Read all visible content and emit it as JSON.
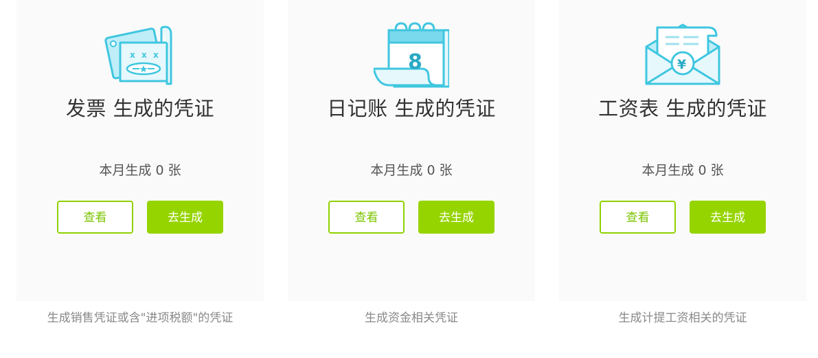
{
  "colors": {
    "accent_green": "#96d400",
    "icon_cyan": "#3fc6e0",
    "icon_fill": "#e6f8fc",
    "card_bg": "#fafafa"
  },
  "cards": [
    {
      "icon": "invoice-icon",
      "title": "发票 生成的凭证",
      "count_text": "本月生成 0 张",
      "view_label": "查看",
      "generate_label": "去生成",
      "description": "生成销售凭证或含\"进项税额\"的凭证"
    },
    {
      "icon": "journal-calendar-icon",
      "title": "日记账 生成的凭证",
      "count_text": "本月生成 0 张",
      "view_label": "查看",
      "generate_label": "去生成",
      "description": "生成资金相关凭证"
    },
    {
      "icon": "payroll-envelope-icon",
      "title": "工资表 生成的凭证",
      "count_text": "本月生成 0 张",
      "view_label": "查看",
      "generate_label": "去生成",
      "description": "生成计提工资相关的凭证"
    }
  ]
}
